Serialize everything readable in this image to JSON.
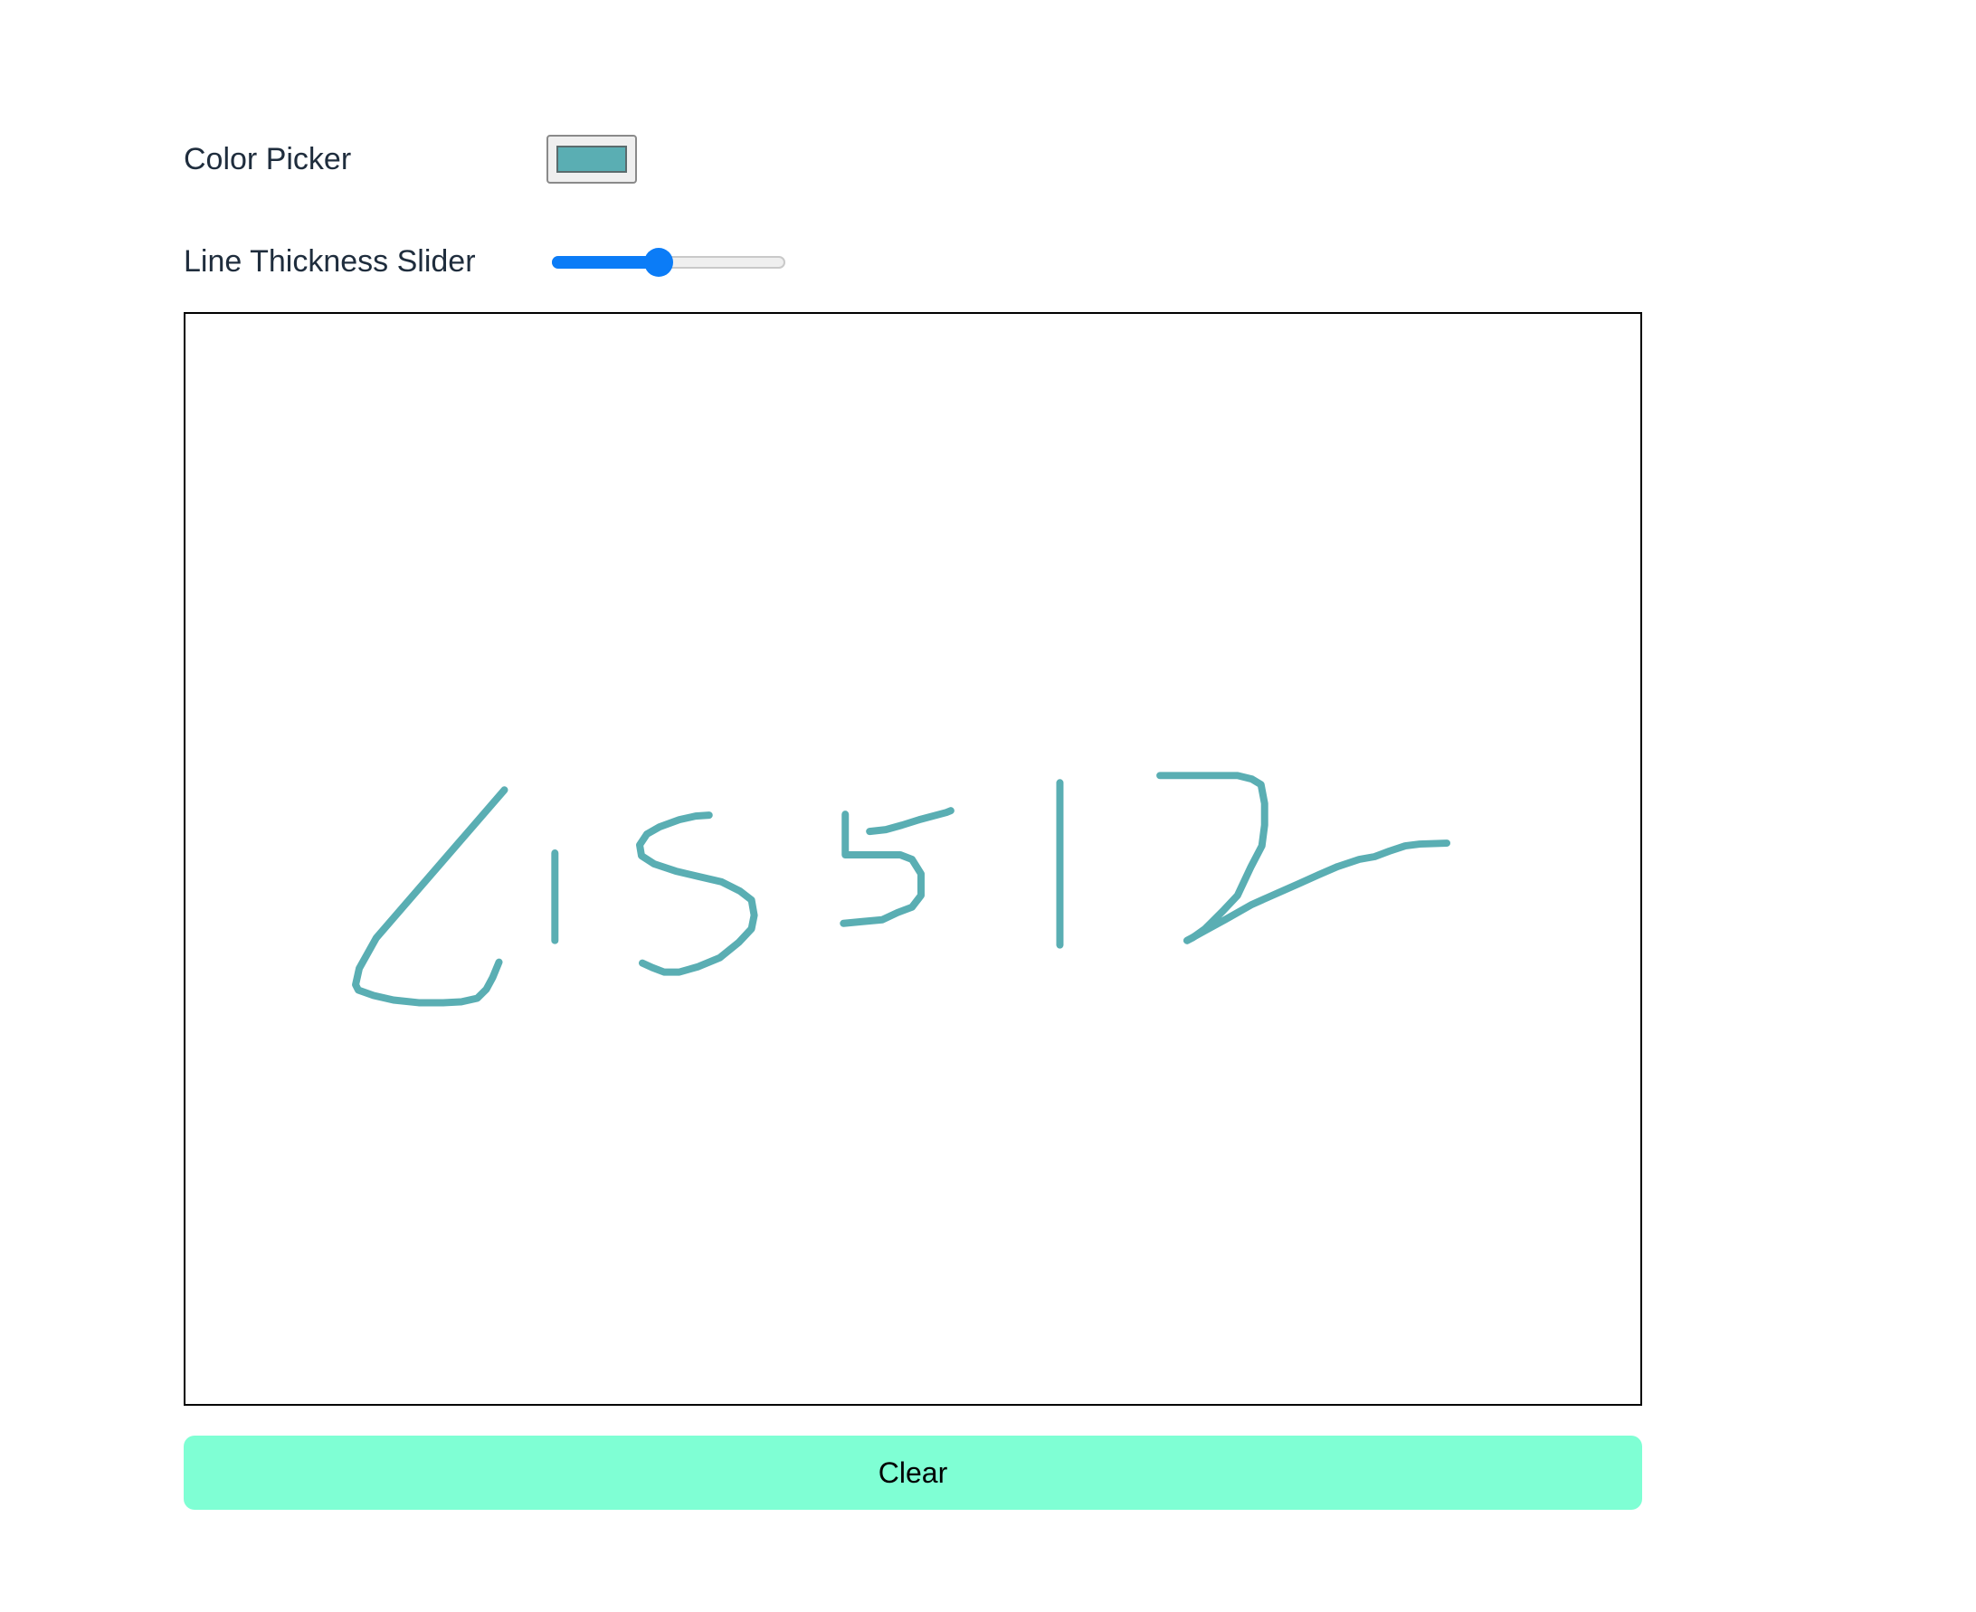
{
  "controls": {
    "color_label": "Color Picker",
    "color_value": "#5aaeb3",
    "thickness_label": "Line Thickness Slider",
    "thickness_fraction": 0.45
  },
  "canvas": {
    "stroke_color": "#5aaeb3",
    "border_color": "#000000"
  },
  "actions": {
    "clear_label": "Clear",
    "clear_bg": "#7fffd4"
  },
  "theme": {
    "accent": "#0b7cf7",
    "label_color": "#1f2d3d"
  }
}
